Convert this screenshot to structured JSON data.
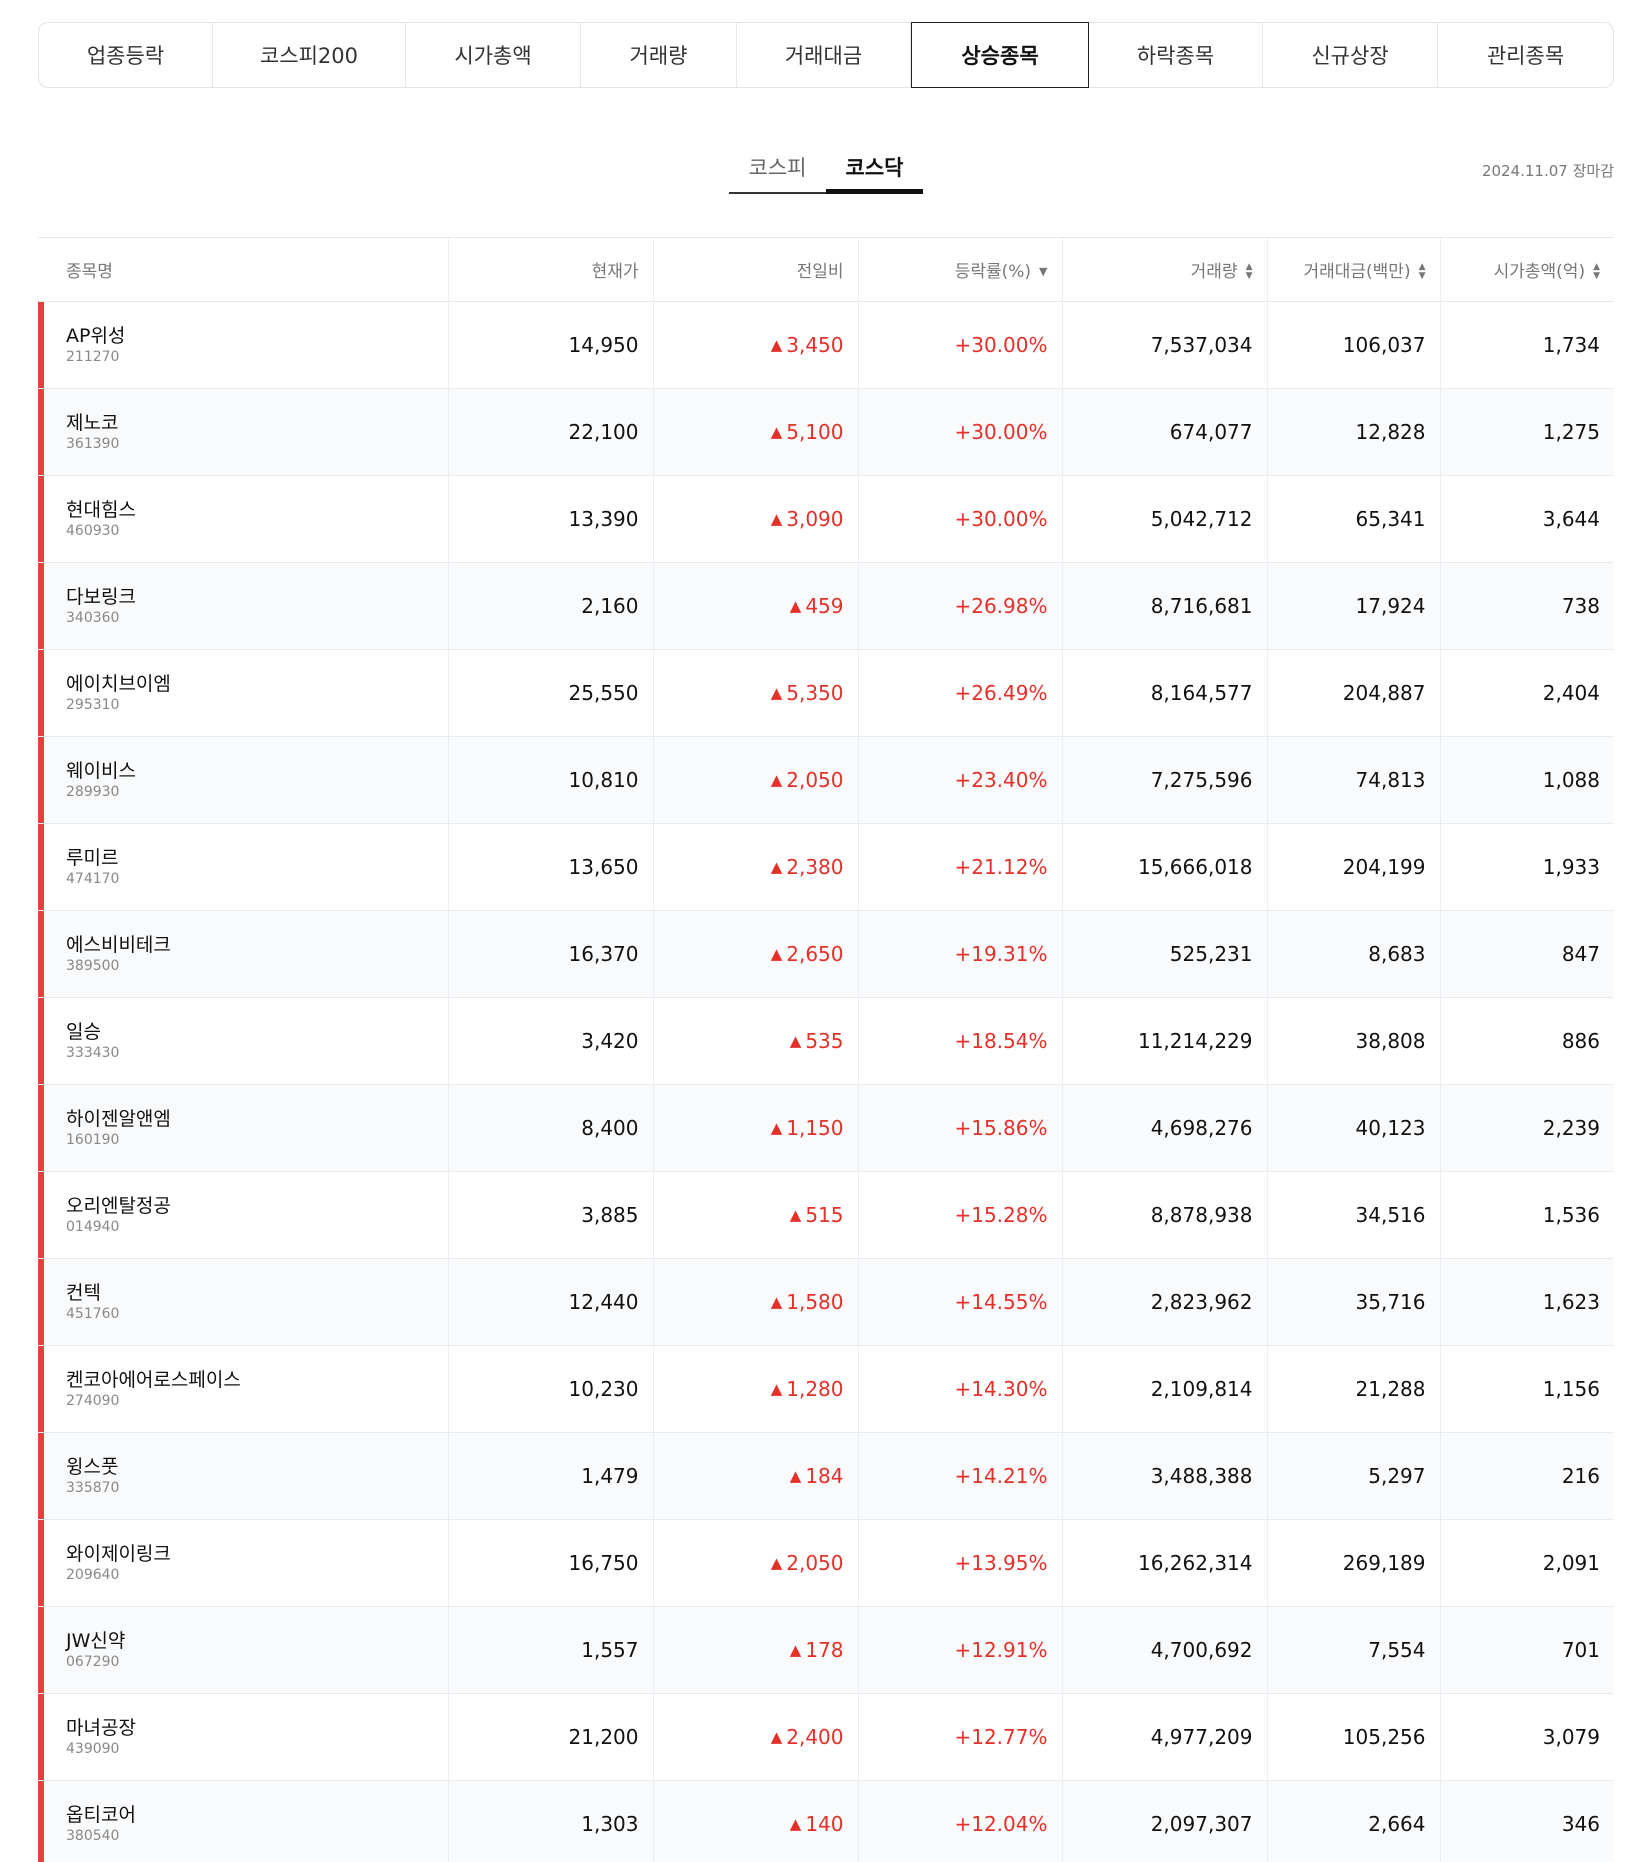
{
  "category_tabs": [
    "업종등락",
    "코스피200",
    "시가총액",
    "거래량",
    "거래대금",
    "상승종목",
    "하락종목",
    "신규상장",
    "관리종목"
  ],
  "market_tabs": [
    "코스피",
    "코스닥"
  ],
  "date_label": "2024.11.07 장마감",
  "columns": {
    "name": "종목명",
    "price": "현재가",
    "change": "전일비",
    "rate": "등락률(%)",
    "volume": "거래량",
    "amount": "거래대금(백만)",
    "cap": "시가총액(억)"
  },
  "icons": {
    "up_triangle": "▲",
    "sort_desc": "▼",
    "sort_up": "▲",
    "sort_down": "▼"
  },
  "colors": {
    "up": "#e5302a",
    "row_marker": "#e5403a"
  },
  "rows": [
    {
      "name": "AP위성",
      "code": "211270",
      "price": "14,950",
      "change": "3,450",
      "rate": "+30.00%",
      "volume": "7,537,034",
      "amount": "106,037",
      "cap": "1,734"
    },
    {
      "name": "제노코",
      "code": "361390",
      "price": "22,100",
      "change": "5,100",
      "rate": "+30.00%",
      "volume": "674,077",
      "amount": "12,828",
      "cap": "1,275"
    },
    {
      "name": "현대힘스",
      "code": "460930",
      "price": "13,390",
      "change": "3,090",
      "rate": "+30.00%",
      "volume": "5,042,712",
      "amount": "65,341",
      "cap": "3,644"
    },
    {
      "name": "다보링크",
      "code": "340360",
      "price": "2,160",
      "change": "459",
      "rate": "+26.98%",
      "volume": "8,716,681",
      "amount": "17,924",
      "cap": "738"
    },
    {
      "name": "에이치브이엠",
      "code": "295310",
      "price": "25,550",
      "change": "5,350",
      "rate": "+26.49%",
      "volume": "8,164,577",
      "amount": "204,887",
      "cap": "2,404"
    },
    {
      "name": "웨이비스",
      "code": "289930",
      "price": "10,810",
      "change": "2,050",
      "rate": "+23.40%",
      "volume": "7,275,596",
      "amount": "74,813",
      "cap": "1,088"
    },
    {
      "name": "루미르",
      "code": "474170",
      "price": "13,650",
      "change": "2,380",
      "rate": "+21.12%",
      "volume": "15,666,018",
      "amount": "204,199",
      "cap": "1,933"
    },
    {
      "name": "에스비비테크",
      "code": "389500",
      "price": "16,370",
      "change": "2,650",
      "rate": "+19.31%",
      "volume": "525,231",
      "amount": "8,683",
      "cap": "847"
    },
    {
      "name": "일승",
      "code": "333430",
      "price": "3,420",
      "change": "535",
      "rate": "+18.54%",
      "volume": "11,214,229",
      "amount": "38,808",
      "cap": "886"
    },
    {
      "name": "하이젠알앤엠",
      "code": "160190",
      "price": "8,400",
      "change": "1,150",
      "rate": "+15.86%",
      "volume": "4,698,276",
      "amount": "40,123",
      "cap": "2,239"
    },
    {
      "name": "오리엔탈정공",
      "code": "014940",
      "price": "3,885",
      "change": "515",
      "rate": "+15.28%",
      "volume": "8,878,938",
      "amount": "34,516",
      "cap": "1,536"
    },
    {
      "name": "컨텍",
      "code": "451760",
      "price": "12,440",
      "change": "1,580",
      "rate": "+14.55%",
      "volume": "2,823,962",
      "amount": "35,716",
      "cap": "1,623"
    },
    {
      "name": "켄코아에어로스페이스",
      "code": "274090",
      "price": "10,230",
      "change": "1,280",
      "rate": "+14.30%",
      "volume": "2,109,814",
      "amount": "21,288",
      "cap": "1,156"
    },
    {
      "name": "윙스풋",
      "code": "335870",
      "price": "1,479",
      "change": "184",
      "rate": "+14.21%",
      "volume": "3,488,388",
      "amount": "5,297",
      "cap": "216"
    },
    {
      "name": "와이제이링크",
      "code": "209640",
      "price": "16,750",
      "change": "2,050",
      "rate": "+13.95%",
      "volume": "16,262,314",
      "amount": "269,189",
      "cap": "2,091"
    },
    {
      "name": "JW신약",
      "code": "067290",
      "price": "1,557",
      "change": "178",
      "rate": "+12.91%",
      "volume": "4,700,692",
      "amount": "7,554",
      "cap": "701"
    },
    {
      "name": "마녀공장",
      "code": "439090",
      "price": "21,200",
      "change": "2,400",
      "rate": "+12.77%",
      "volume": "4,977,209",
      "amount": "105,256",
      "cap": "3,079"
    },
    {
      "name": "옵티코어",
      "code": "380540",
      "price": "1,303",
      "change": "140",
      "rate": "+12.04%",
      "volume": "2,097,307",
      "amount": "2,664",
      "cap": "346"
    }
  ]
}
